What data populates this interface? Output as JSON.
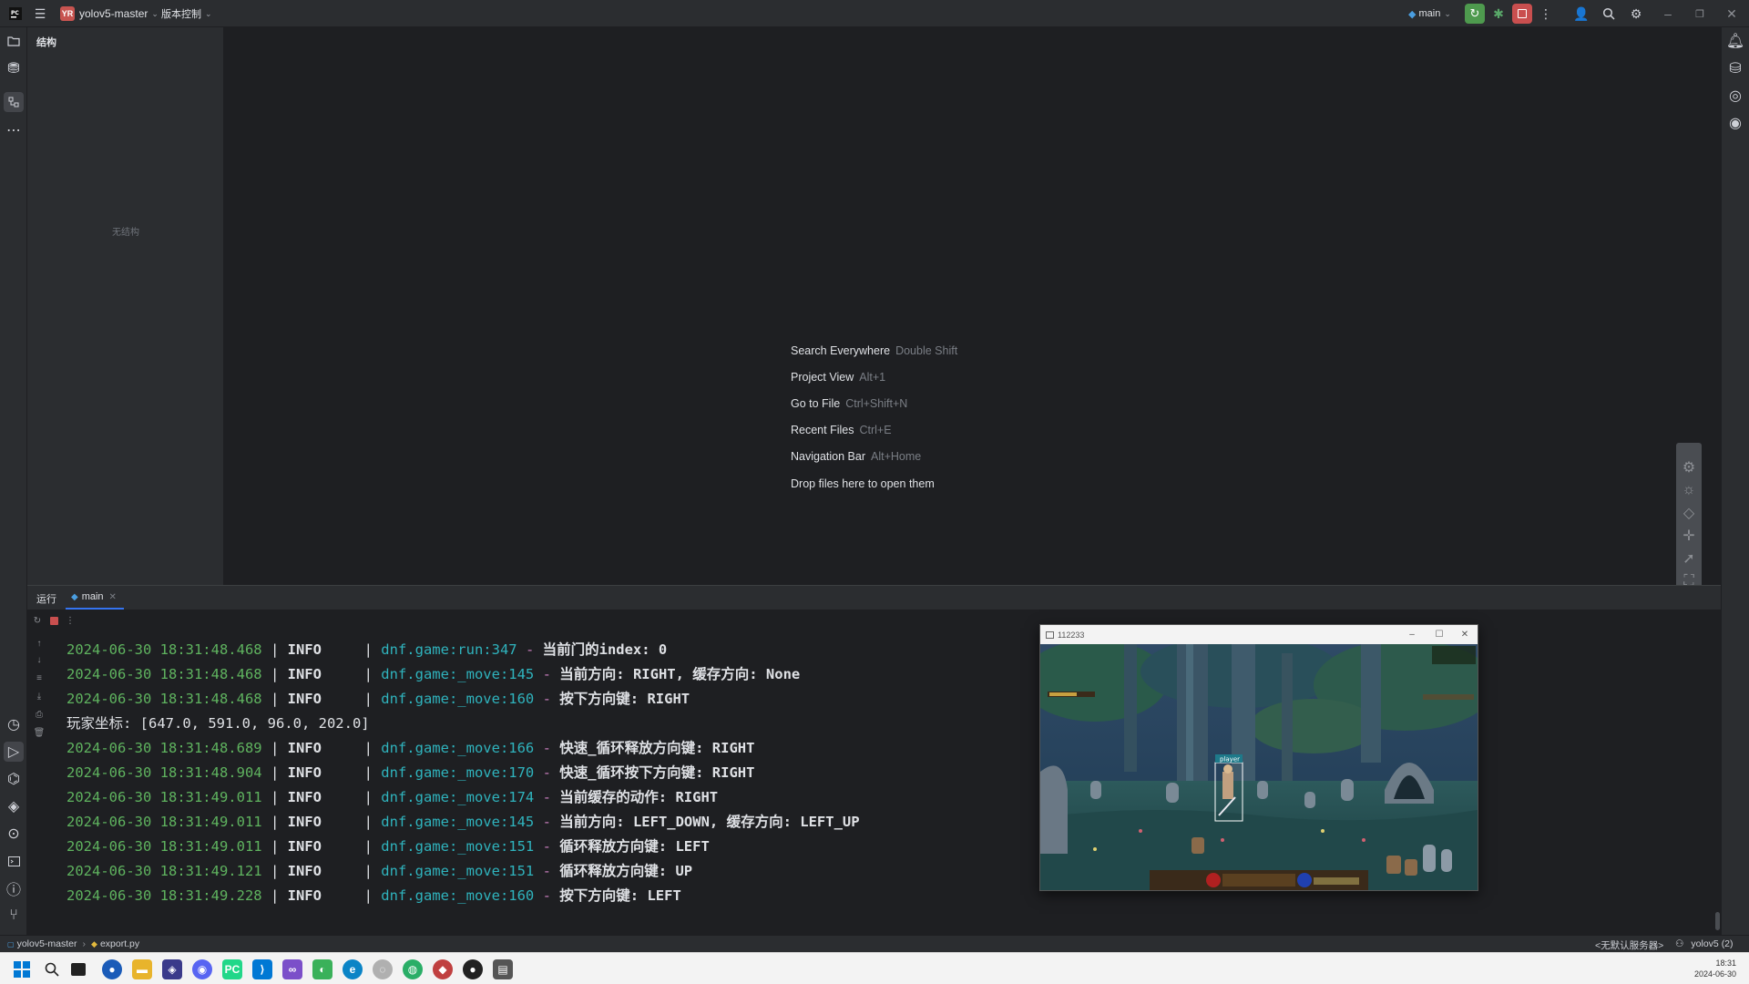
{
  "titlebar": {
    "app_badge": "YR",
    "project_name": "yolov5-master",
    "vcs_label": "版本控制",
    "run_config": "main"
  },
  "structure": {
    "title": "结构",
    "empty_text": "无结构"
  },
  "editor": {
    "hints": [
      {
        "label": "Search Everywhere",
        "key": "Double Shift"
      },
      {
        "label": "Project View",
        "key": "Alt+1"
      },
      {
        "label": "Go to File",
        "key": "Ctrl+Shift+N"
      },
      {
        "label": "Recent Files",
        "key": "Ctrl+E"
      },
      {
        "label": "Navigation Bar",
        "key": "Alt+Home"
      },
      {
        "label": "Drop files here to open them",
        "key": ""
      }
    ]
  },
  "run_panel": {
    "label": "运行",
    "tab": "main",
    "lines": [
      {
        "time": "2024-06-30 18:31:48.468",
        "level": "INFO",
        "src": "dnf.game:run:347",
        "msg": "当前门的index: 0"
      },
      {
        "time": "2024-06-30 18:31:48.468",
        "level": "INFO",
        "src": "dnf.game:_move:145",
        "msg": "当前方向: RIGHT, 缓存方向: None"
      },
      {
        "time": "2024-06-30 18:31:48.468",
        "level": "INFO",
        "src": "dnf.game:_move:160",
        "msg": "按下方向键: RIGHT"
      },
      {
        "plain": "玩家坐标: [647.0, 591.0, 96.0, 202.0]"
      },
      {
        "time": "2024-06-30 18:31:48.689",
        "level": "INFO",
        "src": "dnf.game:_move:166",
        "msg": "快速_循环释放方向键: RIGHT"
      },
      {
        "time": "2024-06-30 18:31:48.904",
        "level": "INFO",
        "src": "dnf.game:_move:170",
        "msg": "快速_循环按下方向键: RIGHT"
      },
      {
        "time": "2024-06-30 18:31:49.011",
        "level": "INFO",
        "src": "dnf.game:_move:174",
        "msg": "当前缓存的动作: RIGHT"
      },
      {
        "time": "2024-06-30 18:31:49.011",
        "level": "INFO",
        "src": "dnf.game:_move:145",
        "msg": "当前方向: LEFT_DOWN, 缓存方向: LEFT_UP"
      },
      {
        "time": "2024-06-30 18:31:49.011",
        "level": "INFO",
        "src": "dnf.game:_move:151",
        "msg": "循环释放方向键: LEFT"
      },
      {
        "time": "2024-06-30 18:31:49.121",
        "level": "INFO",
        "src": "dnf.game:_move:151",
        "msg": "循环释放方向键: UP"
      },
      {
        "time": "2024-06-30 18:31:49.228",
        "level": "INFO",
        "src": "dnf.game:_move:160",
        "msg": "按下方向键: LEFT"
      }
    ]
  },
  "game_window": {
    "title": "112233",
    "player_label": "player"
  },
  "statusbar": {
    "project": "yolov5-master",
    "file": "export.py",
    "server": "<无默认服务器>",
    "interpreter": "yolov5 (2)"
  },
  "taskbar": {
    "time": "18:31",
    "date": "2024-06-30"
  }
}
